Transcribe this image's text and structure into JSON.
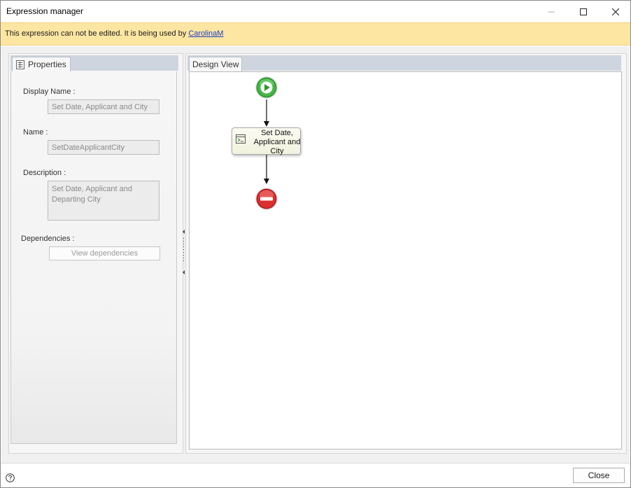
{
  "window": {
    "title": "Expression manager"
  },
  "banner": {
    "message": "This expression can not be edited. It is being used by ",
    "user_link": "CarolinaM",
    "background": "#fde6a2"
  },
  "properties_panel": {
    "tab_label": "Properties",
    "display_name": {
      "label": "Display Name :",
      "value": "Set Date, Applicant and City"
    },
    "name": {
      "label": "Name :",
      "value": "SetDateApplicantCity"
    },
    "description": {
      "label": "Description :",
      "value": "Set Date, Applicant and Departing City"
    },
    "dependencies": {
      "label": "Dependencies :",
      "button_label": "View dependencies"
    }
  },
  "design_view": {
    "tab_label": "Design View",
    "start_node": {
      "icon": "play-icon",
      "color": "#3aa83a"
    },
    "activity_node": {
      "label": "Set Date, Applicant and City",
      "icon": "expression-icon"
    },
    "end_node": {
      "icon": "stop-icon",
      "color": "#d62828"
    }
  },
  "footer": {
    "help_icon": "help-icon",
    "close_label": "Close"
  }
}
